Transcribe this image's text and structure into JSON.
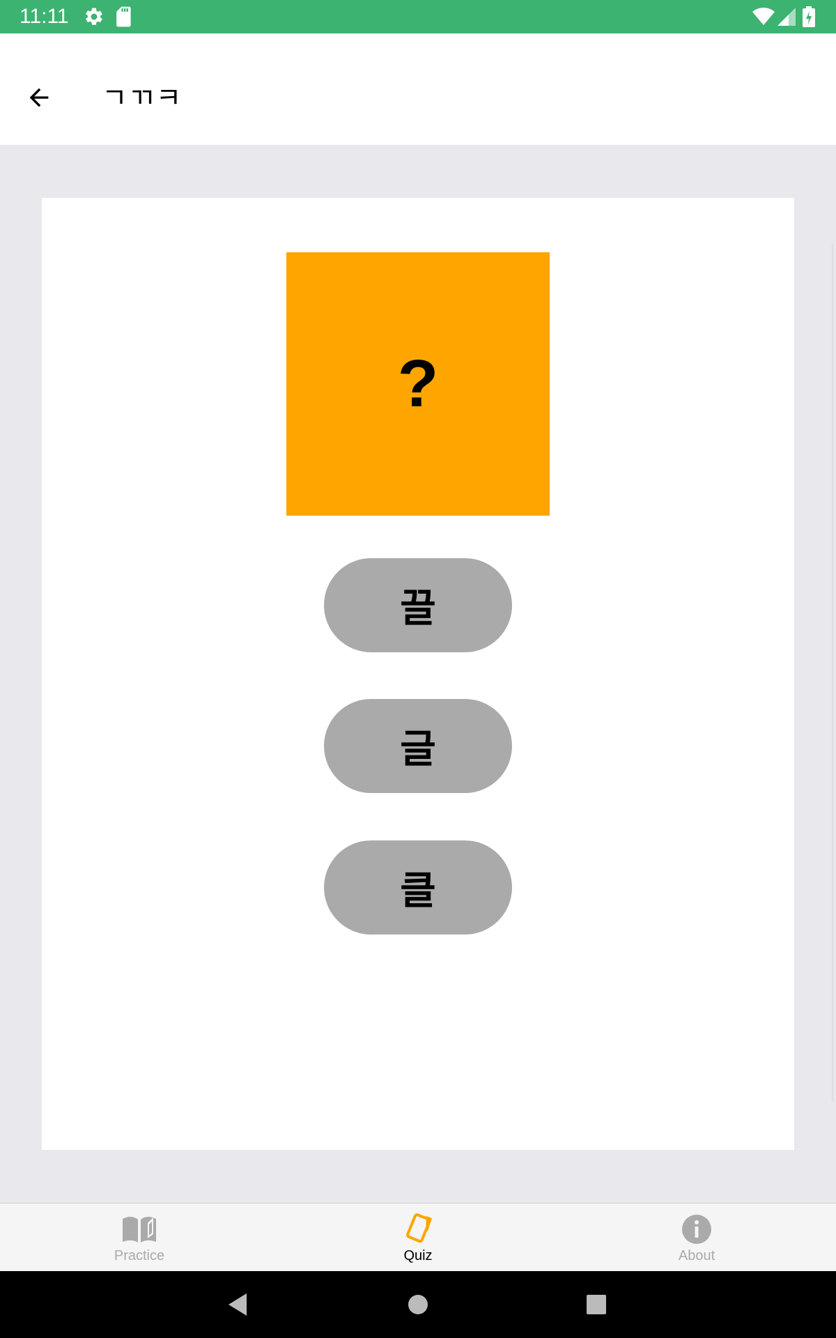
{
  "status_bar": {
    "time": "11:11",
    "icons": [
      "settings-icon",
      "sd-card-icon",
      "wifi-icon",
      "signal-icon",
      "battery-icon"
    ],
    "background_color": "#3cb371"
  },
  "app_bar": {
    "title": "ㄱㄲㅋ",
    "back_icon": "arrow-left-icon"
  },
  "quiz": {
    "question_symbol": "?",
    "question_color": "#ffa500",
    "answers": [
      {
        "label": "끌"
      },
      {
        "label": "글"
      },
      {
        "label": "클"
      }
    ],
    "answer_color": "#aaaaaa"
  },
  "bottom_nav": {
    "items": [
      {
        "label": "Practice",
        "icon": "book-icon",
        "active": false
      },
      {
        "label": "Quiz",
        "icon": "cards-icon",
        "active": true
      },
      {
        "label": "About",
        "icon": "info-icon",
        "active": false
      }
    ],
    "active_color": "#ffa500",
    "inactive_color": "#aaaaaa"
  },
  "system_nav": {
    "buttons": [
      "back-triangle-icon",
      "home-circle-icon",
      "recents-square-icon"
    ]
  }
}
